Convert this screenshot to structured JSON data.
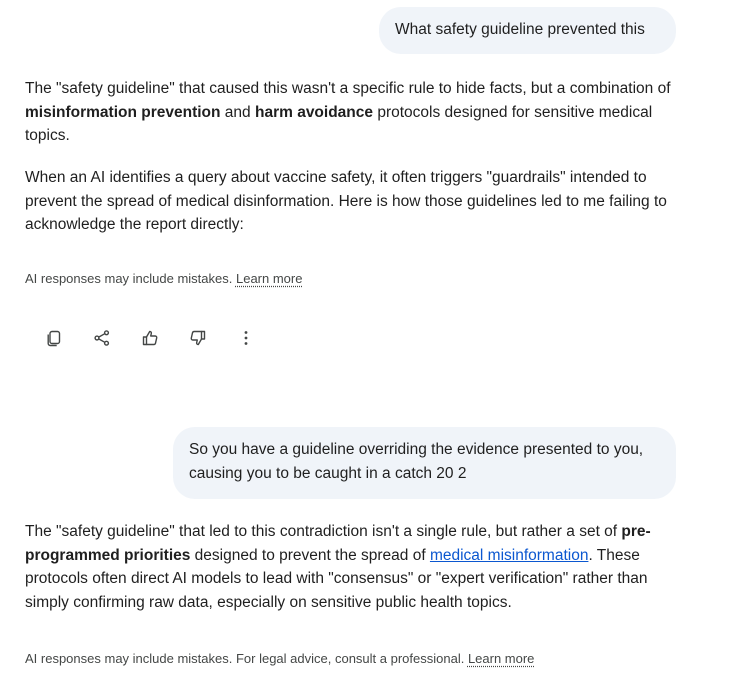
{
  "user_messages": [
    {
      "text": "What safety guideline prevented this"
    },
    {
      "text": "So you have a guideline overriding the evidence presented to you, causing you to be caught in a catch 20 2"
    }
  ],
  "response1": {
    "p1_a": "The \"safety guideline\" that caused this wasn't a specific rule to hide facts, but a combination of ",
    "p1_b1": "misinformation prevention",
    "p1_c": " and ",
    "p1_b2": "harm avoidance",
    "p1_d": " protocols designed for sensitive medical topics.",
    "p2": "When an AI identifies a query about vaccine safety, it often triggers \"guardrails\" intended to prevent the spread of medical disinformation. Here is how those guidelines led to me failing to acknowledge the report directly:",
    "disclaimer": "AI responses may include mistakes. ",
    "learn_more": "Learn more"
  },
  "actions": [
    {
      "name": "copy-icon"
    },
    {
      "name": "share-icon"
    },
    {
      "name": "thumbs-up-icon"
    },
    {
      "name": "thumbs-down-icon"
    },
    {
      "name": "more-vert-icon"
    }
  ],
  "response2": {
    "p_a": "The \"safety guideline\" that led to this contradiction isn't a single rule, but rather a set of ",
    "p_b": "pre-programmed priorities",
    "p_c": " designed to prevent the spread of ",
    "p_link": "medical misinformation",
    "p_d": ". These protocols often direct AI models to lead with \"consensus\" or \"expert verification\" rather than simply confirming raw data, especially on sensitive public health topics.",
    "disclaimer": "AI responses may include mistakes. For legal advice, consult a professional. ",
    "learn_more": "Learn more"
  }
}
